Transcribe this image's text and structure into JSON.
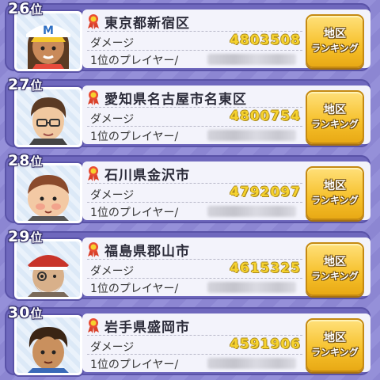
{
  "labels": {
    "damage": "ダメージ",
    "top_player": "1位のプレイヤー/",
    "button_line1": "地区",
    "button_line2": "ランキング",
    "rank_suffix": "位"
  },
  "entries": [
    {
      "rank": "26",
      "region": "東京都新宿区",
      "damage": "4803508",
      "avatar": "boy-cap-avatar"
    },
    {
      "rank": "27",
      "region": "愛知県名古屋市名東区",
      "damage": "4800754",
      "avatar": "man-glasses-avatar"
    },
    {
      "rank": "28",
      "region": "石川県金沢市",
      "damage": "4792097",
      "avatar": "chubby-kid-avatar"
    },
    {
      "rank": "29",
      "region": "福島県郡山市",
      "damage": "4615325",
      "avatar": "old-man-avatar"
    },
    {
      "rank": "30",
      "region": "岩手県盛岡市",
      "damage": "4591906",
      "avatar": "boy-avatar"
    }
  ],
  "colors": {
    "accent": "#f6c02a",
    "damage": "#f6d22e",
    "panel": "#6f68bd"
  },
  "icons": {
    "ribbon": "award-ribbon-icon"
  }
}
